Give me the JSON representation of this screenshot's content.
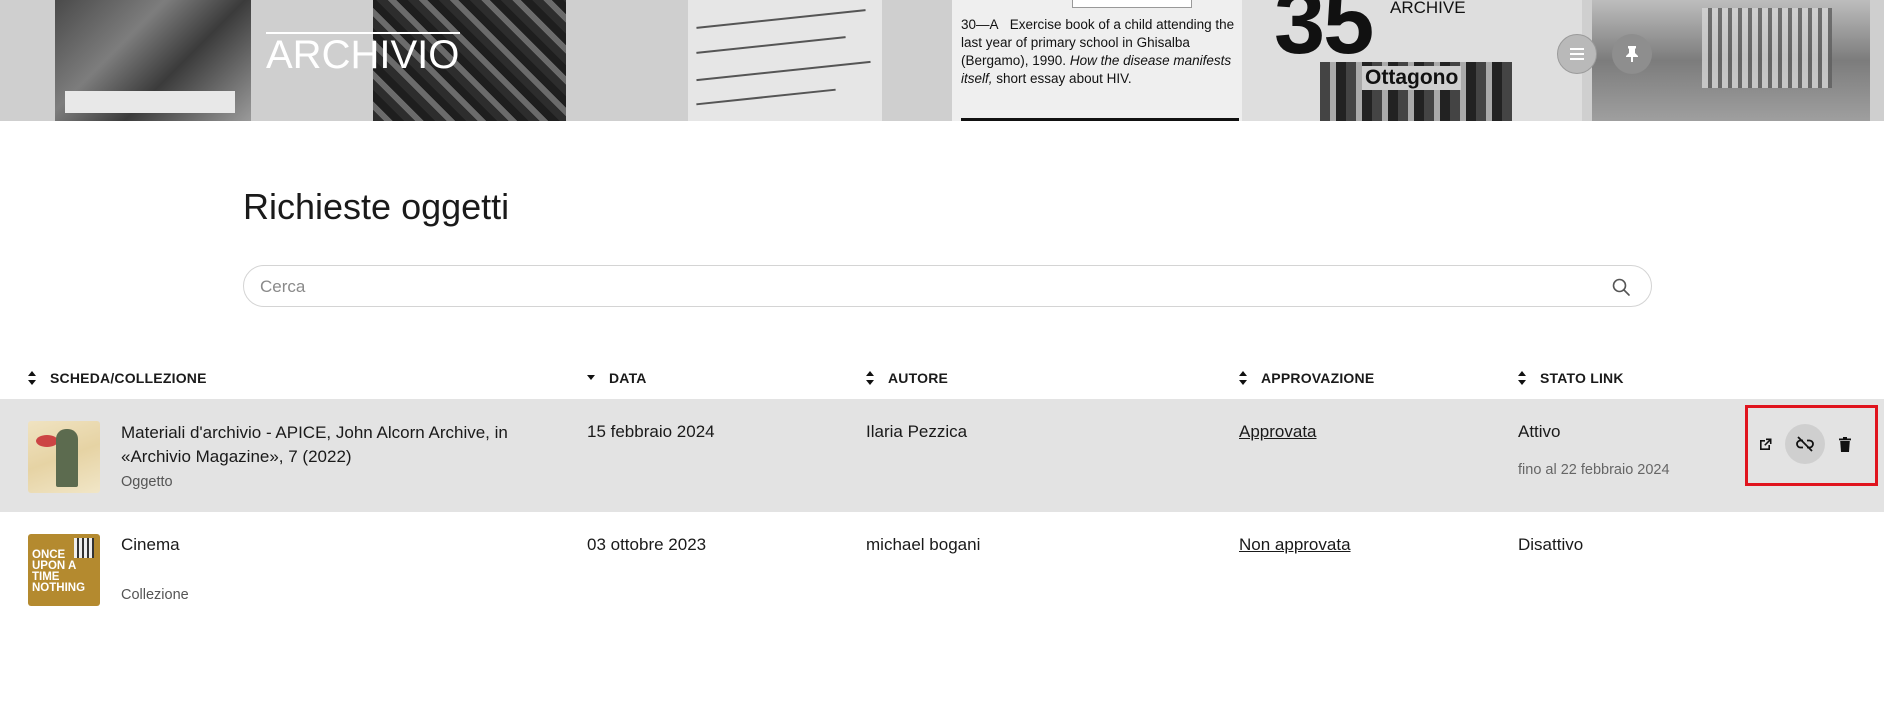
{
  "header": {
    "logo": "ARCHIVIO",
    "banner_caption_num": "30—A",
    "banner_caption_text": "Exercise book of a child attending the last year of primary school in Ghisalba (Bergamo), 1990.",
    "banner_caption_italic": "How the disease manifests itself,",
    "banner_caption_tail": "short essay about HIV.",
    "banner_number": "35",
    "banner_archive": "ARCHIVE",
    "banner_magazine": "Ottagono",
    "menu_icon": "hamburger-icon",
    "pin_icon": "pin-icon"
  },
  "page": {
    "title": "Richieste oggetti",
    "search_placeholder": "Cerca",
    "search_value": ""
  },
  "table": {
    "columns": [
      {
        "label": "SCHEDA/COLLEZIONE",
        "sort": "both"
      },
      {
        "label": "DATA",
        "sort": "desc"
      },
      {
        "label": "AUTORE",
        "sort": "both"
      },
      {
        "label": "APPROVAZIONE",
        "sort": "both"
      },
      {
        "label": "STATO LINK",
        "sort": "both"
      }
    ],
    "rows": [
      {
        "title": "Materiali d'archivio - APICE, John Alcorn Archive, in «Archivio Magazine», 7 (2022)",
        "type": "Oggetto",
        "date": "15 febbraio 2024",
        "author": "Ilaria Pezzica",
        "approval": "Approvata",
        "link_status": "Attivo",
        "link_until": "fino al 22 febbraio 2024"
      },
      {
        "title": "Cinema",
        "type": "Collezione",
        "date": "03 ottobre 2023",
        "author": "michael bogani",
        "approval": "Non approvata",
        "link_status": "Disattivo",
        "link_until": "",
        "thumb_text": "ONCE UPON A TIME NOTHING"
      }
    ]
  },
  "actions": {
    "icons": [
      "external-link-icon",
      "unlink-icon",
      "trash-icon"
    ],
    "highlight_color": "#e0141e"
  }
}
